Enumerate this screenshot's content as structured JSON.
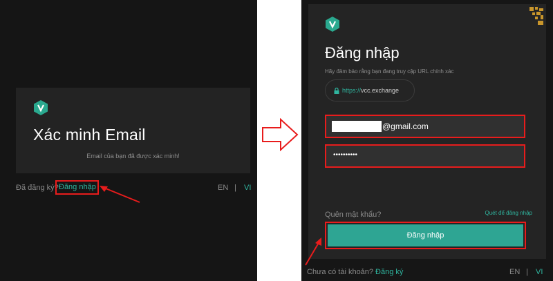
{
  "left": {
    "title": "Xác minh Email",
    "message": "Email của bạn đã được xác minh!",
    "already_registered": "Đã đăng ký?",
    "login_link": "Đăng nhập",
    "lang_en": "EN",
    "lang_sep": "|",
    "lang_vi": "VI"
  },
  "right": {
    "title": "Đăng nhập",
    "subtitle": "Hãy đảm bảo rằng bạn đang truy cập URL chính xác",
    "url_scheme": "https://",
    "url_host": "vcc.exchange",
    "email_suffix": "@gmail.com",
    "password_mask": "••••••••••",
    "forgot_password": "Quên mật khẩu?",
    "qr_login": "Quét để đăng nhập",
    "submit_label": "Đăng nhập",
    "no_account": "Chưa có tài khoản?",
    "signup_link": "Đăng ký",
    "lang_en": "EN",
    "lang_sep": "|",
    "lang_vi": "VI"
  },
  "colors": {
    "accent": "#2fb59f",
    "highlight": "#e81c1c",
    "button": "#2ea593"
  },
  "icons": [
    "vcc-logo-icon",
    "lock-icon",
    "qr-code-icon",
    "arrow-right-icon",
    "annotation-arrow-icon"
  ]
}
